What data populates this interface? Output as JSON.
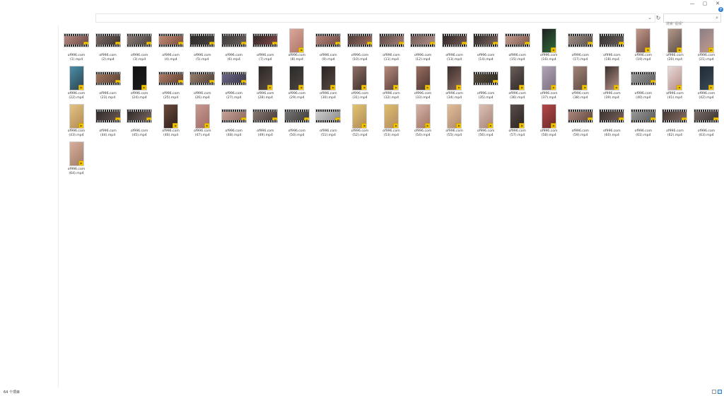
{
  "window": {
    "controls": {
      "minimize": "—",
      "maximize": "▢",
      "close": "✕"
    }
  },
  "toolbar": {
    "dropdown_glyph": "⌄",
    "refresh_glyph": "↻",
    "search_placeholder": "搜索\"视频\"",
    "search_icon": "search-icon",
    "help_glyph": "?"
  },
  "files": [
    {
      "name": "of996.com\n(1).mp4",
      "orientation": "landscape",
      "colors": [
        "#b98b84",
        "#6a4741"
      ]
    },
    {
      "name": "of996.com\n(2).mp4",
      "orientation": "landscape",
      "colors": [
        "#7d6b66",
        "#3b3230"
      ]
    },
    {
      "name": "of996.com\n(3).mp4",
      "orientation": "landscape",
      "colors": [
        "#8a7d78",
        "#4a403d"
      ]
    },
    {
      "name": "of996.com\n(4).mp4",
      "orientation": "landscape",
      "colors": [
        "#c28e79",
        "#7b4a3a"
      ]
    },
    {
      "name": "of996.com\n(5).mp4",
      "orientation": "landscape",
      "colors": [
        "#2b2b2b",
        "#4b4340"
      ]
    },
    {
      "name": "of996.com\n(6).mp4",
      "orientation": "landscape",
      "colors": [
        "#3a3a3a",
        "#70625e"
      ]
    },
    {
      "name": "of996.com\n(7).mp4",
      "orientation": "landscape",
      "colors": [
        "#2d2727",
        "#8b4a4a"
      ]
    },
    {
      "name": "of996.com\n(8).mp4",
      "orientation": "portrait",
      "colors": [
        "#d8a79b",
        "#b07568"
      ]
    },
    {
      "name": "of996.com\n(9).mp4",
      "orientation": "landscape",
      "colors": [
        "#b7847a",
        "#6f4a44"
      ]
    },
    {
      "name": "of996.com\n(10).mp4",
      "orientation": "landscape",
      "colors": [
        "#4a3c39",
        "#a36f62"
      ]
    },
    {
      "name": "of996.com\n(11).mp4",
      "orientation": "landscape",
      "colors": [
        "#5c4b48",
        "#a88078"
      ]
    },
    {
      "name": "of996.com\n(12).mp4",
      "orientation": "landscape",
      "colors": [
        "#6d5956",
        "#b8938b"
      ]
    },
    {
      "name": "of996.com\n(13).mp4",
      "orientation": "landscape",
      "colors": [
        "#2a2424",
        "#7c5f5a"
      ]
    },
    {
      "name": "of996.com\n(14).mp4",
      "orientation": "landscape",
      "colors": [
        "#2d2a29",
        "#866b64"
      ]
    },
    {
      "name": "of996.com\n(15).mp4",
      "orientation": "landscape",
      "colors": [
        "#c79e90",
        "#7a564b"
      ]
    },
    {
      "name": "of996.com\n(16).mp4",
      "orientation": "portrait",
      "colors": [
        "#1f1f22",
        "#2f6e37"
      ]
    },
    {
      "name": "of996.com\n(17).mp4",
      "orientation": "landscape",
      "colors": [
        "#a08f88",
        "#5c514c"
      ]
    },
    {
      "name": "of996.com\n(18).mp4",
      "orientation": "landscape",
      "colors": [
        "#343232",
        "#6e625d"
      ]
    },
    {
      "name": "of996.com\n(19).mp4",
      "orientation": "portrait",
      "colors": [
        "#c49a8c",
        "#6a4a42"
      ]
    },
    {
      "name": "of996.com\n(20).mp4",
      "orientation": "portrait",
      "colors": [
        "#b4988a",
        "#5d4e48"
      ]
    },
    {
      "name": "of996.com\n(21).mp4",
      "orientation": "portrait",
      "colors": [
        "#8b7f86",
        "#c39a8c"
      ]
    },
    {
      "name": "of996.com\n(22).mp4",
      "orientation": "portrait",
      "colors": [
        "#4c8ea6",
        "#2b4450"
      ]
    },
    {
      "name": "of996.com\n(23).mp4",
      "orientation": "landscape",
      "colors": [
        "#a37a62",
        "#5a3f32"
      ]
    },
    {
      "name": "of996.com\n(24).mp4",
      "orientation": "portrait",
      "colors": [
        "#111111",
        "#1c1c1c"
      ]
    },
    {
      "name": "of996.com\n(25).mp4",
      "orientation": "landscape",
      "colors": [
        "#b07f69",
        "#5f3d30"
      ]
    },
    {
      "name": "of996.com\n(26).mp4",
      "orientation": "landscape",
      "colors": [
        "#9c806f",
        "#4f3f37"
      ]
    },
    {
      "name": "of996.com\n(27).mp4",
      "orientation": "landscape",
      "colors": [
        "#6f6a8a",
        "#3a3648"
      ]
    },
    {
      "name": "of996.com\n(28).mp4",
      "orientation": "portrait",
      "colors": [
        "#2a2624",
        "#5a4c44"
      ]
    },
    {
      "name": "of996.com\n(29).mp4",
      "orientation": "portrait",
      "colors": [
        "#2b2a28",
        "#4b4440"
      ]
    },
    {
      "name": "of996.com\n(30).mp4",
      "orientation": "portrait",
      "colors": [
        "#2a2522",
        "#564842"
      ]
    },
    {
      "name": "of996.com\n(31).mp4",
      "orientation": "portrait",
      "colors": [
        "#8d6f66",
        "#3f302c"
      ]
    },
    {
      "name": "of996.com\n(32).mp4",
      "orientation": "portrait",
      "colors": [
        "#b68a7d",
        "#5b413a"
      ]
    },
    {
      "name": "of996.com\n(33).mp4",
      "orientation": "portrait",
      "colors": [
        "#9a6f62",
        "#4a3430"
      ]
    },
    {
      "name": "of996.com\n(34).mp4",
      "orientation": "portrait",
      "colors": [
        "#3a2e2c",
        "#8a6a60"
      ]
    },
    {
      "name": "of996.com\n(35).mp4",
      "orientation": "landscape",
      "colors": [
        "#5a5040",
        "#2e2a22"
      ]
    },
    {
      "name": "of996.com\n(36).mp4",
      "orientation": "portrait",
      "colors": [
        "#6a5e5a",
        "#2e2826"
      ]
    },
    {
      "name": "of996.com\n(37).mp4",
      "orientation": "portrait",
      "colors": [
        "#b0a6b8",
        "#7a6e80"
      ]
    },
    {
      "name": "of996.com\n(38).mp4",
      "orientation": "portrait",
      "colors": [
        "#a28478",
        "#5e4a42"
      ]
    },
    {
      "name": "of996.com\n(39).mp4",
      "orientation": "portrait",
      "colors": [
        "#3a302e",
        "#b9958a"
      ]
    },
    {
      "name": "of996.com\n(40).mp4",
      "orientation": "landscape",
      "colors": [
        "#9a9a9a",
        "#5f5f5f"
      ]
    },
    {
      "name": "of996.com\n(41).mp4",
      "orientation": "portrait",
      "colors": [
        "#e8dada",
        "#b58c86"
      ]
    },
    {
      "name": "of996.com\n(42).mp4",
      "orientation": "portrait",
      "colors": [
        "#1f2a34",
        "#3c4a58"
      ]
    },
    {
      "name": "of996.com\n(43).mp4",
      "orientation": "portrait",
      "colors": [
        "#e2c486",
        "#b38a52"
      ]
    },
    {
      "name": "of996.com\n(44).mp4",
      "orientation": "landscape",
      "colors": [
        "#2c2828",
        "#6e5c56"
      ]
    },
    {
      "name": "of996.com\n(45).mp4",
      "orientation": "landscape",
      "colors": [
        "#2a2626",
        "#7c6a64"
      ]
    },
    {
      "name": "of996.com\n(46).mp4",
      "orientation": "portrait",
      "colors": [
        "#6b4a3e",
        "#2e201a"
      ]
    },
    {
      "name": "of996.com\n(47).mp4",
      "orientation": "portrait",
      "colors": [
        "#c89a92",
        "#a06a66"
      ]
    },
    {
      "name": "of996.com\n(48).mp4",
      "orientation": "landscape",
      "colors": [
        "#c9a59a",
        "#8c665c"
      ]
    },
    {
      "name": "of996.com\n(49).mp4",
      "orientation": "landscape",
      "colors": [
        "#8a7a74",
        "#453a36"
      ]
    },
    {
      "name": "of996.com\n(50).mp4",
      "orientation": "landscape",
      "colors": [
        "#7a7876",
        "#3c3a38"
      ]
    },
    {
      "name": "of996.com\n(51).mp4",
      "orientation": "landscape",
      "colors": [
        "#d0d0d0",
        "#8a8a8a"
      ]
    },
    {
      "name": "of996.com\n(52).mp4",
      "orientation": "portrait",
      "colors": [
        "#e2c470",
        "#b08a58"
      ]
    },
    {
      "name": "of996.com\n(53).mp4",
      "orientation": "portrait",
      "colors": [
        "#ddbf6e",
        "#b58b62"
      ]
    },
    {
      "name": "of996.com\n(54).mp4",
      "orientation": "portrait",
      "colors": [
        "#d6b4a8",
        "#a07466"
      ]
    },
    {
      "name": "of996.com\n(55).mp4",
      "orientation": "portrait",
      "colors": [
        "#e0c09a",
        "#b08870"
      ]
    },
    {
      "name": "of996.com\n(56).mp4",
      "orientation": "portrait",
      "colors": [
        "#dcc0b4",
        "#a8847a"
      ]
    },
    {
      "name": "of996.com\n(57).mp4",
      "orientation": "portrait",
      "colors": [
        "#5a4e4a",
        "#2a2422"
      ]
    },
    {
      "name": "of996.com\n(58).mp4",
      "orientation": "portrait",
      "colors": [
        "#b34848",
        "#6e2a2a"
      ]
    },
    {
      "name": "of996.com\n(59).mp4",
      "orientation": "landscape",
      "colors": [
        "#b08a7e",
        "#5e463e"
      ]
    },
    {
      "name": "of996.com\n(60).mp4",
      "orientation": "landscape",
      "colors": [
        "#3a3230",
        "#7a625a"
      ]
    },
    {
      "name": "of996.com\n(61).mp4",
      "orientation": "landscape",
      "colors": [
        "#9a9a9a",
        "#5a5a5a"
      ]
    },
    {
      "name": "of996.com\n(62).mp4",
      "orientation": "landscape",
      "colors": [
        "#3e3634",
        "#8a6e66"
      ]
    },
    {
      "name": "of996.com\n(63).mp4",
      "orientation": "landscape",
      "colors": [
        "#7a6e68",
        "#3a3230"
      ]
    },
    {
      "name": "of996.com\n(64).mp4",
      "orientation": "portrait",
      "colors": [
        "#d8b09c",
        "#a07c6a"
      ]
    }
  ],
  "status": {
    "item_count": "64 个项目"
  },
  "accent_color": "#2f7fd6",
  "badge_color": "#f2c500"
}
